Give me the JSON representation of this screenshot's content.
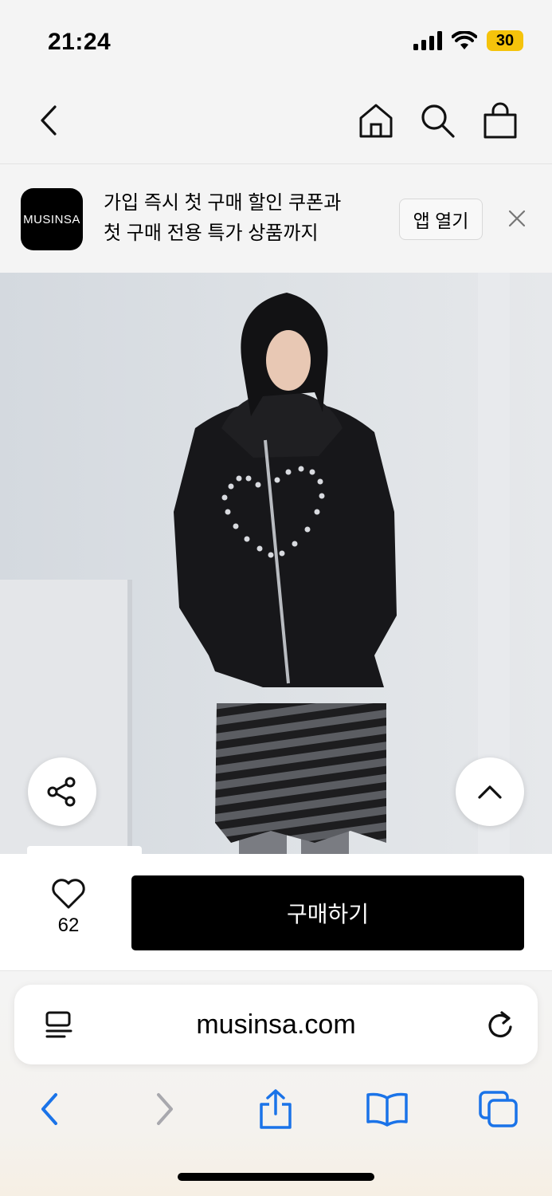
{
  "status_bar": {
    "time": "21:24",
    "battery": "30"
  },
  "banner": {
    "logo": "MUSINSA",
    "line1": "가입 즉시 첫 구매 할인 쿠폰과",
    "line2": "첫 구매 전용 특가 상품까지",
    "open_button": "앱 열기"
  },
  "purchase": {
    "like_count": "62",
    "buy_label": "구매하기"
  },
  "browser": {
    "url": "musinsa.com"
  },
  "icons": {
    "back": "chevron-left-icon",
    "home": "home-icon",
    "search": "search-icon",
    "cart": "shopping-bag-icon",
    "share": "share-icon",
    "top": "chevron-up-icon",
    "like": "heart-icon"
  },
  "colors": {
    "accent_blue": "#1a73e8",
    "battery_yellow": "#f5c30b",
    "buy_button": "#000000"
  }
}
